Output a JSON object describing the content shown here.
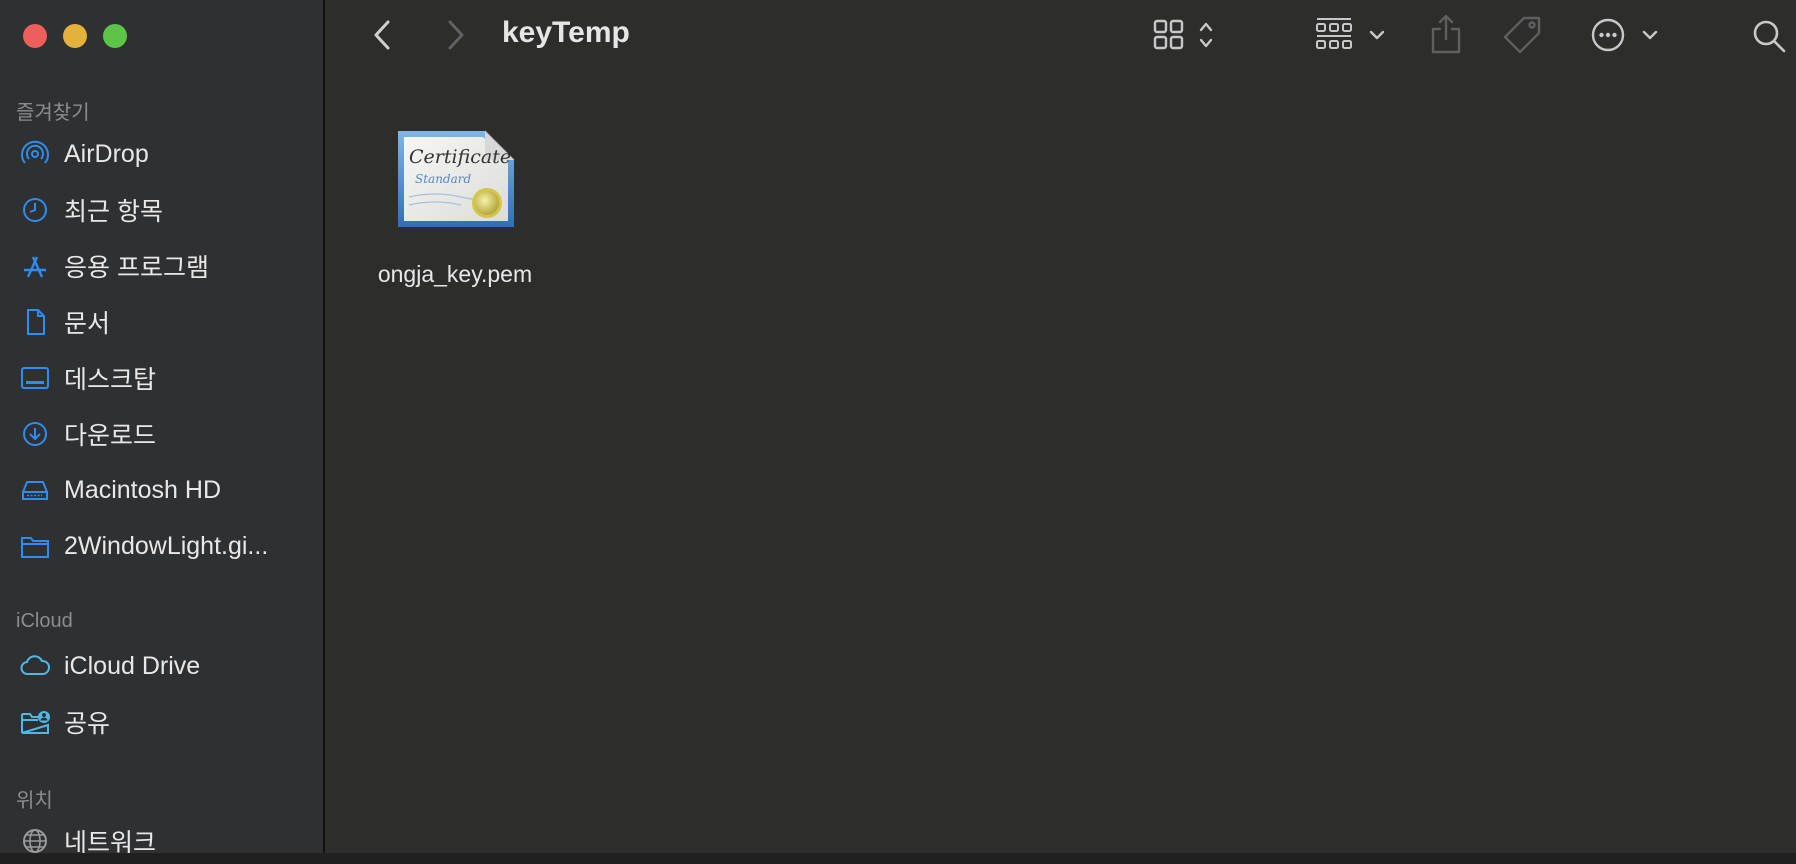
{
  "window": {
    "title": "keyTemp"
  },
  "sidebar": {
    "favorites_label": "즐겨찾기",
    "favorites": [
      {
        "label": "AirDrop",
        "icon": "airdrop-icon"
      },
      {
        "label": "최근 항목",
        "icon": "clock-icon"
      },
      {
        "label": "응용 프로그램",
        "icon": "applications-icon"
      },
      {
        "label": "문서",
        "icon": "document-icon"
      },
      {
        "label": "데스크탑",
        "icon": "desktop-icon"
      },
      {
        "label": "다운로드",
        "icon": "download-icon"
      },
      {
        "label": "Macintosh HD",
        "icon": "drive-icon"
      },
      {
        "label": "2WindowLight.gi...",
        "icon": "folder-icon"
      }
    ],
    "icloud_label": "iCloud",
    "icloud": [
      {
        "label": "iCloud Drive",
        "icon": "cloud-icon"
      },
      {
        "label": "공유",
        "icon": "shared-folder-icon"
      }
    ],
    "locations_label": "위치",
    "locations": [
      {
        "label": "네트워크",
        "icon": "network-icon"
      }
    ]
  },
  "content": {
    "files": [
      {
        "name": "ongja_key.pem",
        "icon": "certificate-icon",
        "icon_text_1": "Certificate",
        "icon_text_2": "Standard"
      }
    ]
  },
  "colors": {
    "accent": "#2f8cf0",
    "sidebar_bg": "#2f3032",
    "content_bg": "#2d2e2c",
    "close": "#ec5f5a",
    "minimize": "#e4b23c",
    "zoom": "#5ec447"
  }
}
